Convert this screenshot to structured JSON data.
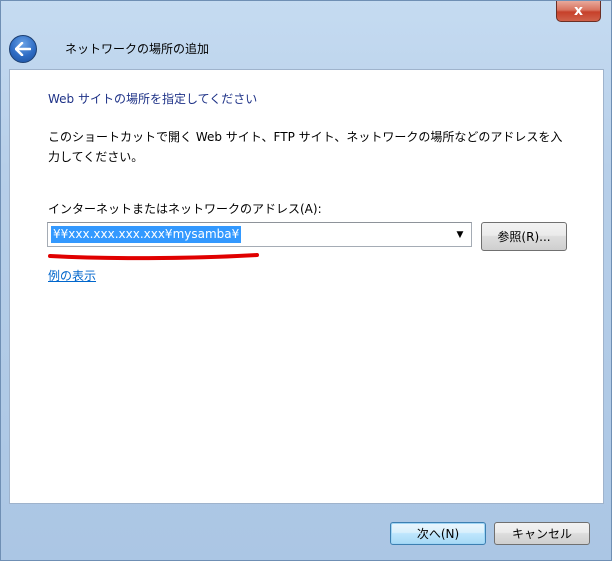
{
  "window": {
    "title": "ネットワークの場所の追加",
    "close_glyph": "x"
  },
  "main": {
    "heading": "Web サイトの場所を指定してください",
    "instruction": "このショートカットで開く Web サイト、FTP サイト、ネットワークの場所などのアドレスを入力してください。",
    "address_label": "インターネットまたはネットワークのアドレス(A):",
    "address_value": "¥¥xxx.xxx.xxx.xxx¥mysamba¥",
    "browse_label": "参照(R)...",
    "example_link": "例の表示"
  },
  "footer": {
    "next_label": "次へ(N)",
    "cancel_label": "キャンセル"
  },
  "colors": {
    "selection": "#3399ff",
    "annotation": "#e00000",
    "link": "#0066cc",
    "heading": "#1e3287"
  },
  "icons": {
    "back": "back-arrow-icon",
    "close": "close-icon",
    "dropdown": "chevron-down-icon"
  }
}
